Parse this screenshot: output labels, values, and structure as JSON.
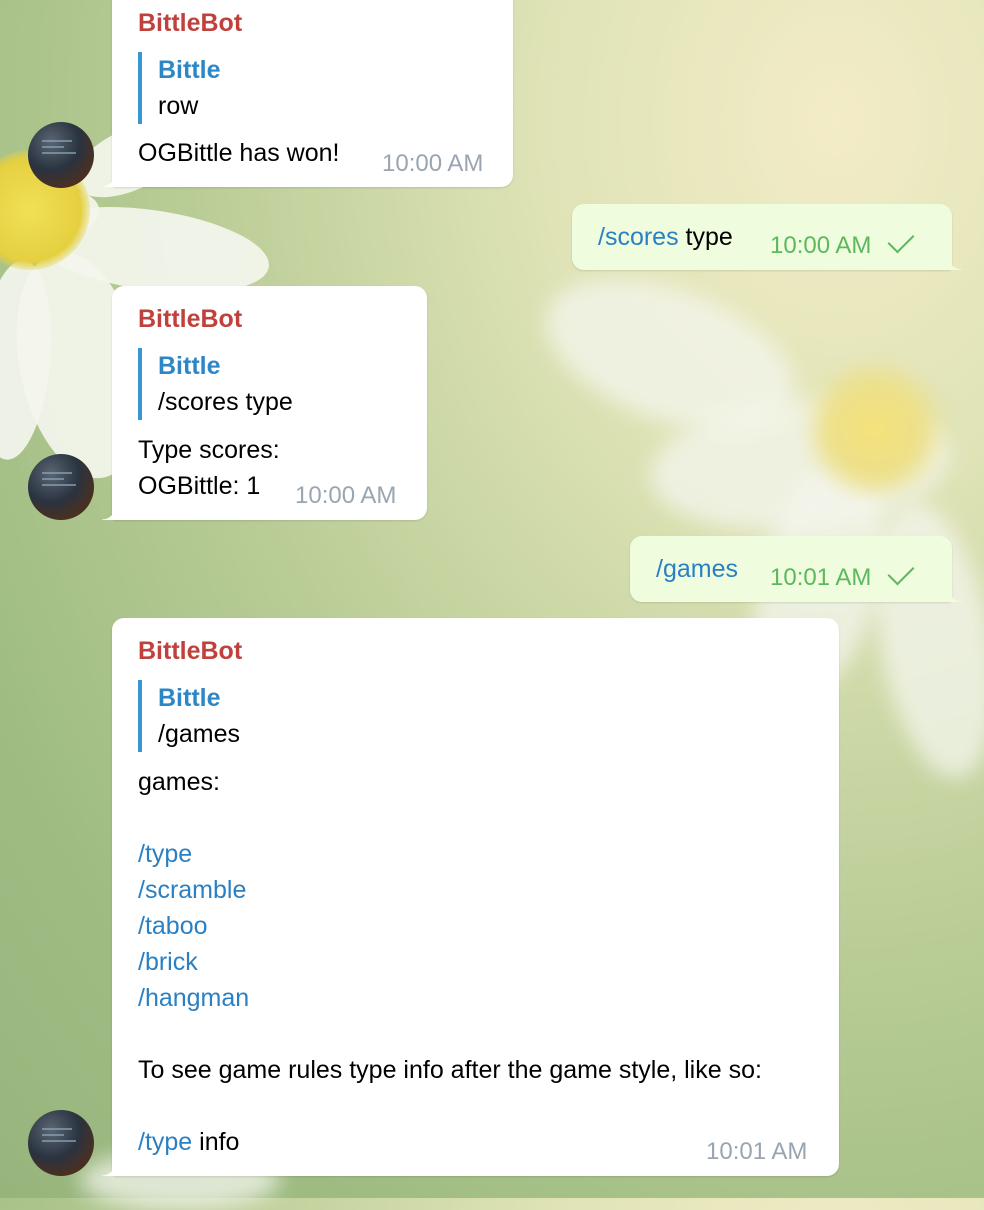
{
  "messages": [
    {
      "sender": "BittleBot",
      "quote_author": "Bittle",
      "quote_text": "row",
      "text": "OGBittle has won!",
      "time": "10:00 AM"
    },
    {
      "command": "/scores",
      "arg": "type",
      "time": "10:00 AM"
    },
    {
      "sender": "BittleBot",
      "quote_author": "Bittle",
      "quote_text": "/scores type",
      "line1": "Type scores:",
      "line2": "OGBittle: 1",
      "time": "10:00 AM"
    },
    {
      "command": "/games",
      "time": "10:01 AM"
    },
    {
      "sender": "BittleBot",
      "quote_author": "Bittle",
      "quote_text": "/games",
      "heading": "games:",
      "games": [
        "/type",
        "/scramble",
        "/taboo",
        "/brick",
        "/hangman"
      ],
      "rules_text": "To see game rules type info after the game style, like so:",
      "example_command": "/type",
      "example_arg": "info",
      "time": "10:01 AM"
    }
  ],
  "colors": {
    "sender": "#c0413c",
    "quote_author": "#2d87c6",
    "link": "#2a80c3",
    "outgoing_bubble": "#effdde",
    "outgoing_time": "#5cb85c",
    "incoming_time": "#9aa5b0"
  }
}
